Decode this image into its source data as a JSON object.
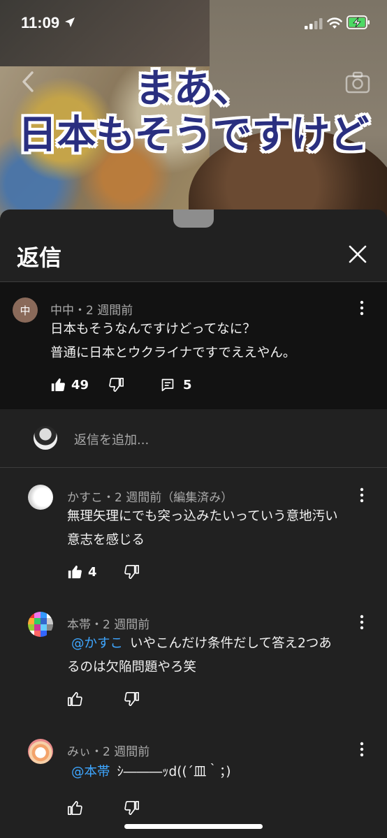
{
  "status_bar": {
    "time": "11:09"
  },
  "video": {
    "caption_line1": "まあ、",
    "caption_line2": "日本もそうですけど"
  },
  "sheet": {
    "title": "返信"
  },
  "parent_comment": {
    "avatar_letter": "中",
    "author": "中中",
    "time": "2 週間前",
    "text_line1": "日本もそうなんですけどってなに？",
    "text_line2": "普通に日本とウクライナですでええやん。",
    "likes": "49",
    "replies": "5"
  },
  "add_reply": {
    "placeholder": "返信を追加..."
  },
  "replies": [
    {
      "author": "かすこ",
      "time": "2 週間前（編集済み）",
      "text_line1": "無理矢理にでも突っ込みたいっていう意地汚い",
      "text_line2": "意志を感じる",
      "likes": "4"
    },
    {
      "author": "本帯",
      "time": "2 週間前",
      "mention": "@かすこ",
      "text_line1": "いやこんだけ条件だして答え2つあ",
      "text_line2": "るのは欠陥問題やろ笑"
    },
    {
      "author": "みぃ",
      "time": "2 週間前",
      "mention": "@本帯",
      "text_line1": "ｼ―――ｯd((´皿｀；)"
    }
  ],
  "separator": "・",
  "colors": {
    "accent_link": "#3ea6ff",
    "sheet_bg": "#212121",
    "parent_bg": "#121212",
    "avatar_brown": "#8a6a5a"
  },
  "icons": [
    "location-arrow-icon",
    "signal-icon",
    "wifi-icon",
    "battery-charging-icon",
    "back-icon",
    "camera-icon",
    "close-icon",
    "kebab-menu-icon",
    "thumb-up-icon",
    "thumb-down-icon",
    "reply-comment-icon"
  ]
}
